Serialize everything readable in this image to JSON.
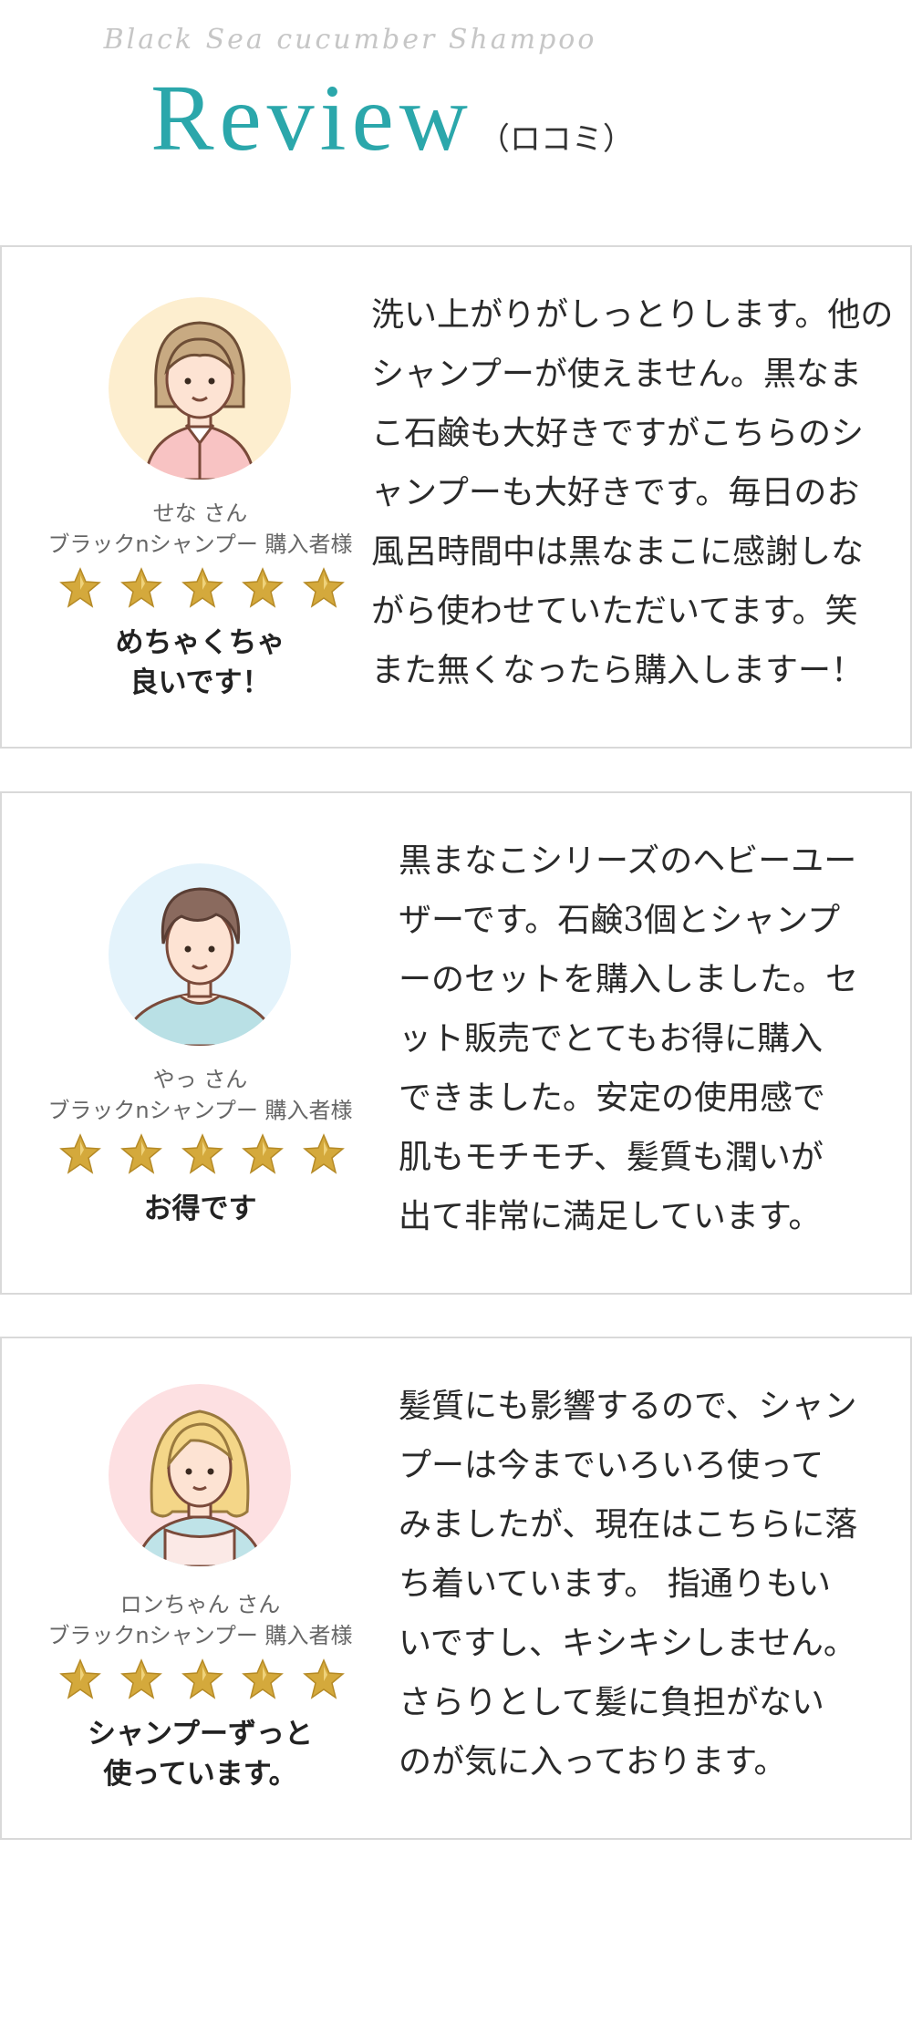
{
  "header": {
    "subtitle": "Black Sea cucumber Shampoo",
    "title": "Review",
    "title_sub": "（ロコミ）"
  },
  "colors": {
    "accent": "#2ba7ab",
    "star_gold": "#d4a93c",
    "border": "#d9d9d9"
  },
  "reviews": [
    {
      "reviewer": "せな さん",
      "product": "ブラックnシャンプー 購入者様",
      "rating": 5,
      "headline": "めちゃくちゃ\n良いです！",
      "body": "洗い上がりがしっとりします。他の\nシャンプーが使えません。黒なま\nこ石鹸も大好きですがこちらのシ\nャンプーも大好きです。毎日のお\n風呂時間中は黒なまこに感謝しな\nがら使わせていただいてます。笑\nまた無くなったら購入しますー！",
      "avatar_icon": "woman-short-hair-avatar-icon",
      "avatar_bg": "#fdeecf"
    },
    {
      "reviewer": "やっ さん",
      "product": "ブラックnシャンプー 購入者様",
      "rating": 5,
      "headline": "お得です",
      "body": "黒まなこシリーズのヘビーユー\nザーです。石鹸3個とシャンプ\nーのセットを購入しました。セ\nット販売でとてもお得に購入\nできました。安定の使用感で\n肌もモチモチ、髪質も潤いが\n出て非常に満足しています。",
      "avatar_icon": "man-avatar-icon",
      "avatar_bg": "#e4f3fb"
    },
    {
      "reviewer": "ロンちゃん さん",
      "product": "ブラックnシャンプー 購入者様",
      "rating": 5,
      "headline": "シャンプーずっと\n使っています。",
      "body": "髪質にも影響するので、シャン\nプーは今までいろいろ使って\nみましたが、現在はこちらに落\nち着いています。 指通りもい\nいですし、キシキシしません。\nさらりとして髪に負担がない\nのが気に入っております。",
      "avatar_icon": "woman-blonde-hair-avatar-icon",
      "avatar_bg": "#fde0e2"
    }
  ]
}
